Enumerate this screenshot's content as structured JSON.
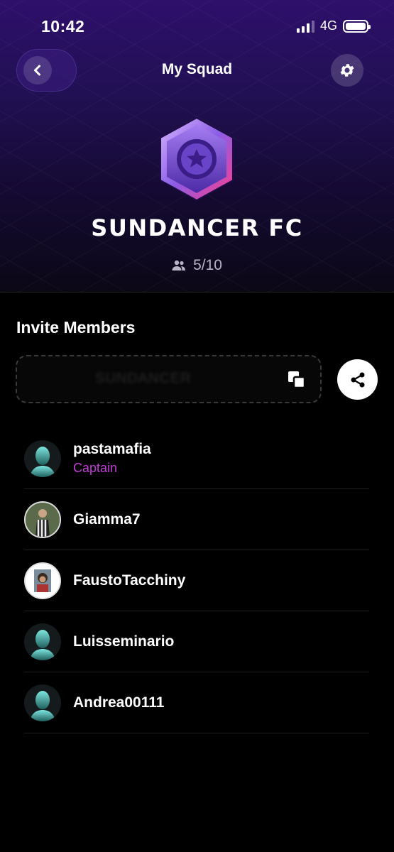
{
  "status_bar": {
    "time": "10:42",
    "network": "4G"
  },
  "header": {
    "title": "My Squad"
  },
  "squad": {
    "name": "SUNDANCER FC",
    "member_count": "5/10"
  },
  "invite": {
    "heading": "Invite Members",
    "code": "SUNDANCER"
  },
  "members": [
    {
      "name": "pastamafia",
      "role": "Captain",
      "avatar": "default-silhouette"
    },
    {
      "name": "Giamma7",
      "role": "",
      "avatar": "photo"
    },
    {
      "name": "FaustoTacchiny",
      "role": "",
      "avatar": "photo"
    },
    {
      "name": "Luisseminario",
      "role": "",
      "avatar": "default-silhouette"
    },
    {
      "name": "Andrea00111",
      "role": "",
      "avatar": "default-silhouette"
    }
  ],
  "colors": {
    "accent_purple": "#c23ad8",
    "badge_purple": "#7b4fd6",
    "hero_top": "#2e0f6b"
  },
  "icons": [
    "back-arrow-icon",
    "gear-icon",
    "badge-icon",
    "people-icon",
    "copy-icon",
    "share-icon",
    "signal-icon",
    "battery-icon"
  ]
}
